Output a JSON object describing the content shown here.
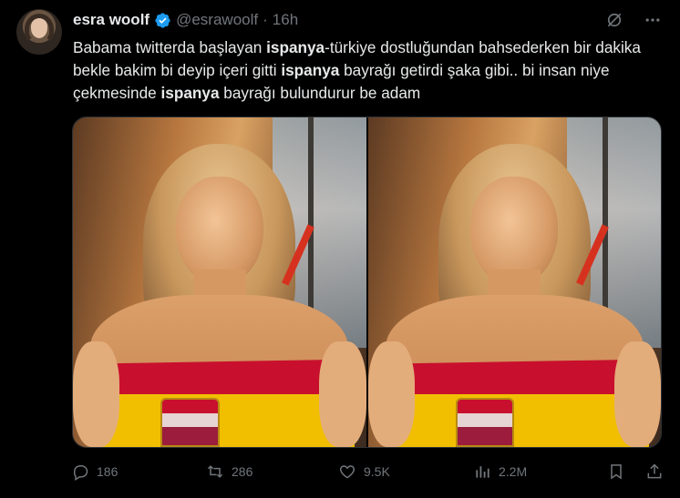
{
  "tweet": {
    "author_name": "esra woolf",
    "handle": "@esrawoolf",
    "separator": "·",
    "time": "16h",
    "text_segments": [
      {
        "t": "Babama twitterda başlayan ",
        "b": false
      },
      {
        "t": "ispanya",
        "b": true
      },
      {
        "t": "-türkiye dostluğundan bahsederken bir dakika bekle bakim bi deyip içeri gitti ",
        "b": false
      },
      {
        "t": "ispanya",
        "b": true
      },
      {
        "t": " bayrağı getirdi şaka gibi.. bi insan niye çekmesinde ",
        "b": false
      },
      {
        "t": "ispanya",
        "b": true
      },
      {
        "t": " bayrağı bulundurur be adam",
        "b": false
      }
    ],
    "media": [
      {
        "icon": "photo-1"
      },
      {
        "icon": "photo-2"
      }
    ],
    "actions": {
      "replies": "186",
      "reposts": "286",
      "likes": "9.5K",
      "views": "2.2M"
    }
  },
  "colors": {
    "background": "#000000",
    "text": "#e7e9ea",
    "muted": "#71767b",
    "verified": "#1d9bf0"
  }
}
